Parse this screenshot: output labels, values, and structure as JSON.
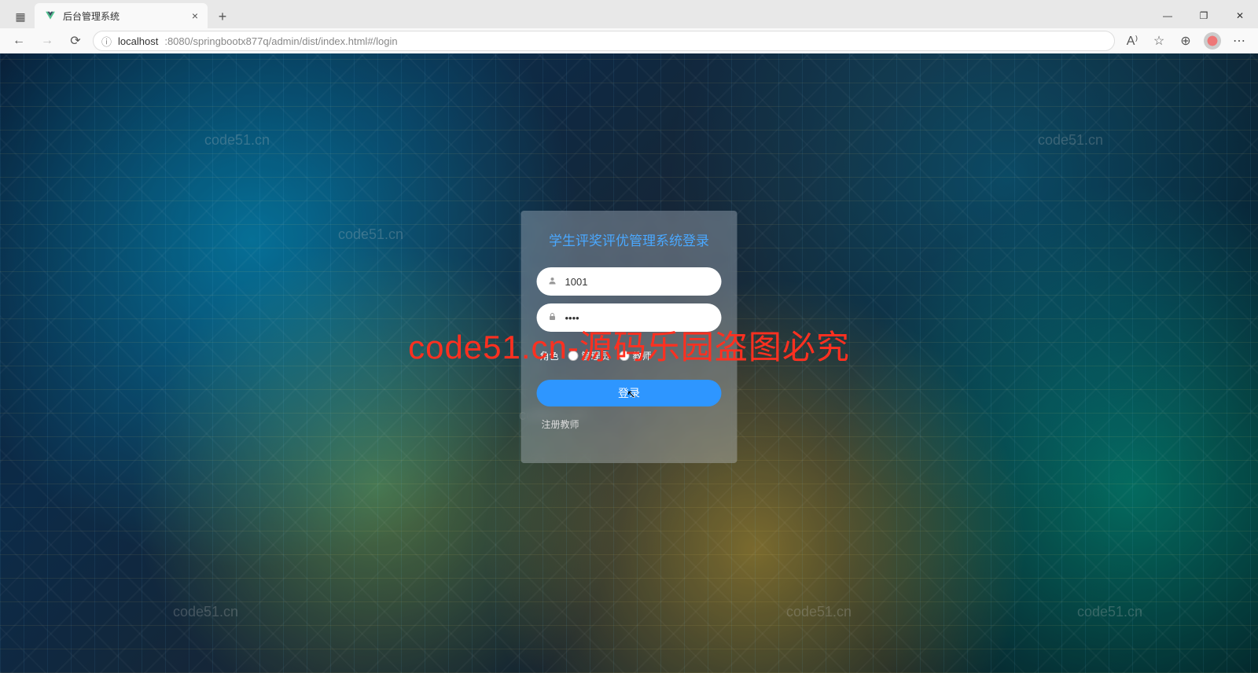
{
  "browser": {
    "tab_title": "后台管理系统",
    "url_host": "localhost",
    "url_port_path": ":8080/springbootx877q/admin/dist/index.html#/login"
  },
  "watermark": {
    "small": "code51.cn",
    "big": "code51.cn-源码乐园盗图必究"
  },
  "login": {
    "title": "学生评奖评优管理系统登录",
    "username_value": "1001",
    "password_value": "••••",
    "role_label": "角色",
    "role_options": [
      {
        "label": "管理员"
      },
      {
        "label": "教师"
      }
    ],
    "login_button": "登录",
    "register_link": "注册教师"
  }
}
